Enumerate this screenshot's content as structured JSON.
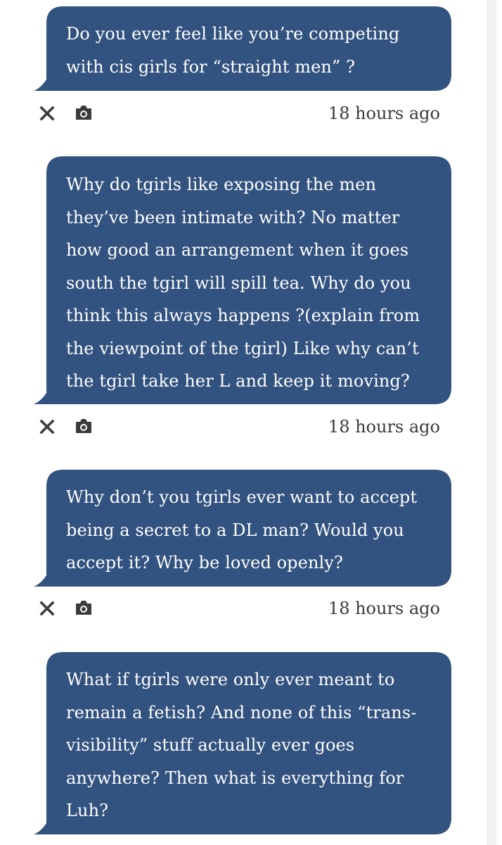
{
  "colors": {
    "bubble": "#32527f",
    "bubble_text": "#ffffff",
    "icon": "#3b3b3b",
    "timestamp": "#3a3a3a",
    "background": "#ffffff"
  },
  "messages": [
    {
      "text": "Do you ever feel like you’re competing\nwith cis girls for “straight men” ?",
      "timestamp": "18 hours ago"
    },
    {
      "text": "Why do tgirls like exposing the men\nthey’ve been intimate with? No matter\nhow good an arrangement when it goes\nsouth the tgirl will spill tea. Why do you\nthink this always happens ?(explain from\nthe viewpoint of the tgirl) Like why can’t\nthe tgirl take her L and keep it moving?",
      "timestamp": "18 hours ago"
    },
    {
      "text": "Why don’t you tgirls ever want to accept\nbeing a secret to a DL man? Would you\naccept it? Why be loved openly?",
      "timestamp": "18 hours ago"
    },
    {
      "text": "What if tgirls were only ever meant to\nremain a fetish? And none of this “trans-\nvisibility” stuff actually ever goes\nanywhere? Then what is everything for\nLuh?"
    }
  ],
  "icons": {
    "dismiss": "close-icon",
    "screenshot": "camera-icon"
  }
}
